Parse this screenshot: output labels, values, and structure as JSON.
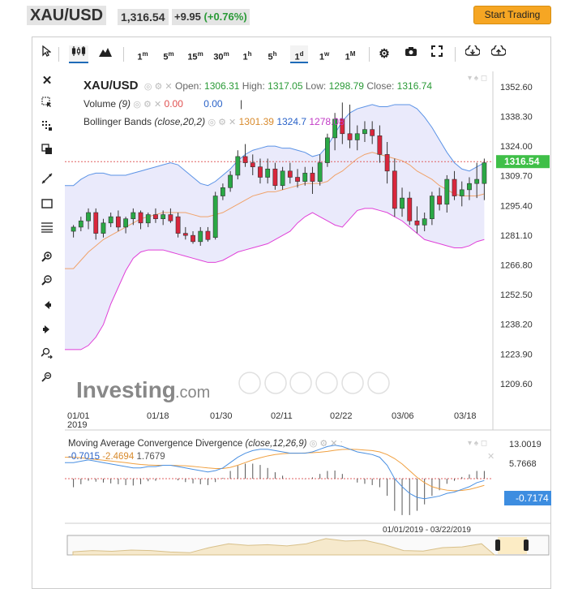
{
  "header": {
    "symbol": "XAU/USD",
    "price": "1,316.54",
    "change": "+9.95",
    "change_pct": "(+0.76%)",
    "trade_button": "Start Trading"
  },
  "toolbar": {
    "intervals": [
      "1m",
      "5m",
      "15m",
      "30m",
      "1h",
      "5h",
      "1d",
      "1w",
      "1M"
    ],
    "active_interval": "1d"
  },
  "legend": {
    "symbol": "XAU/USD",
    "open_label": "Open:",
    "open": "1306.31",
    "high_label": "High:",
    "high": "1317.05",
    "low_label": "Low:",
    "low": "1298.79",
    "close_label": "Close:",
    "close": "1316.74",
    "volume_label": "Volume",
    "volume_param": "(9)",
    "volume_v1": "0.00",
    "volume_v2": "0.00",
    "volume_v3": "|",
    "bb_label": "Bollinger Bands",
    "bb_param": "(close,20,2)",
    "bb_mid": "1301.39",
    "bb_up": "1324.7",
    "bb_low": "1278.08"
  },
  "macd": {
    "label": "Moving Average Convergence Divergence",
    "param": "(close,12,26,9)",
    "v1": "-0.7015",
    "v2": "-2.4694",
    "v3": "1.7679"
  },
  "watermark": {
    "brand": "Investing",
    "suffix": ".com"
  },
  "colors": {
    "up": "#2aa845",
    "down": "#d9263c",
    "bb_mid": "#f0a36b",
    "bb_up": "#5b93e6",
    "bb_low": "#e040d8",
    "bb_fill": "#e8e8fb",
    "macd": "#4a90e2",
    "signal": "#f0a040",
    "price_tag": "#3fbf48"
  },
  "chart_data": [
    {
      "type": "candlestick",
      "title": "XAU/USD",
      "x_labels": [
        "01/01\n2019",
        "01/18",
        "01/30",
        "02/11",
        "02/22",
        "03/06",
        "03/18"
      ],
      "y_ticks": [
        1352.6,
        1338.3,
        1324.0,
        1309.7,
        1295.4,
        1281.1,
        1266.8,
        1252.5,
        1238.2,
        1223.9,
        1209.6
      ],
      "ylim": [
        1199,
        1360
      ],
      "last_price": "1316.54",
      "candles": [
        [
          1283,
          1286,
          1280,
          1285
        ],
        [
          1285,
          1290,
          1283,
          1288
        ],
        [
          1288,
          1294,
          1284,
          1292
        ],
        [
          1292,
          1294,
          1279,
          1282
        ],
        [
          1282,
          1289,
          1280,
          1287
        ],
        [
          1287,
          1292,
          1285,
          1290
        ],
        [
          1290,
          1293,
          1283,
          1285
        ],
        [
          1285,
          1290,
          1282,
          1289
        ],
        [
          1289,
          1294,
          1286,
          1292
        ],
        [
          1292,
          1293,
          1284,
          1287
        ],
        [
          1287,
          1292,
          1285,
          1291
        ],
        [
          1291,
          1294,
          1287,
          1289
        ],
        [
          1289,
          1293,
          1286,
          1291
        ],
        [
          1291,
          1294,
          1287,
          1288
        ],
        [
          1290,
          1292,
          1280,
          1282
        ],
        [
          1282,
          1285,
          1279,
          1281
        ],
        [
          1281,
          1283,
          1277,
          1278
        ],
        [
          1278,
          1285,
          1276,
          1283
        ],
        [
          1283,
          1285,
          1278,
          1279
        ],
        [
          1280,
          1302,
          1279,
          1300
        ],
        [
          1300,
          1306,
          1298,
          1304
        ],
        [
          1304,
          1312,
          1302,
          1310
        ],
        [
          1310,
          1322,
          1308,
          1319
        ],
        [
          1319,
          1325,
          1314,
          1316
        ],
        [
          1316,
          1320,
          1310,
          1314
        ],
        [
          1314,
          1318,
          1306,
          1309
        ],
        [
          1309,
          1318,
          1306,
          1313
        ],
        [
          1313,
          1316,
          1303,
          1305
        ],
        [
          1305,
          1314,
          1303,
          1312
        ],
        [
          1312,
          1316,
          1306,
          1309
        ],
        [
          1309,
          1313,
          1304,
          1307
        ],
        [
          1307,
          1314,
          1305,
          1311
        ],
        [
          1311,
          1314,
          1301,
          1307
        ],
        [
          1307,
          1320,
          1305,
          1316
        ],
        [
          1316,
          1330,
          1314,
          1328
        ],
        [
          1328,
          1340,
          1322,
          1337
        ],
        [
          1337,
          1345,
          1325,
          1330
        ],
        [
          1330,
          1344,
          1323,
          1327
        ],
        [
          1327,
          1334,
          1322,
          1330
        ],
        [
          1330,
          1336,
          1326,
          1332
        ],
        [
          1332,
          1336,
          1325,
          1329
        ],
        [
          1329,
          1334,
          1316,
          1320
        ],
        [
          1320,
          1326,
          1306,
          1312
        ],
        [
          1312,
          1318,
          1290,
          1294
        ],
        [
          1294,
          1304,
          1290,
          1299
        ],
        [
          1299,
          1302,
          1286,
          1288
        ],
        [
          1288,
          1295,
          1282,
          1286
        ],
        [
          1286,
          1292,
          1283,
          1289
        ],
        [
          1289,
          1302,
          1286,
          1300
        ],
        [
          1300,
          1304,
          1293,
          1296
        ],
        [
          1296,
          1310,
          1292,
          1308
        ],
        [
          1308,
          1312,
          1298,
          1300
        ],
        [
          1300,
          1307,
          1295,
          1303
        ],
        [
          1303,
          1309,
          1298,
          1306
        ],
        [
          1306,
          1316,
          1299,
          1308
        ],
        [
          1306,
          1318,
          1298,
          1316
        ]
      ],
      "bb_upper": [
        1305,
        1308,
        1310,
        1311,
        1311,
        1310,
        1310,
        1310,
        1311,
        1312,
        1313,
        1314,
        1315,
        1316,
        1315,
        1312,
        1309,
        1306,
        1305,
        1307,
        1310,
        1313,
        1317,
        1320,
        1322,
        1323,
        1324,
        1324,
        1323,
        1323,
        1322,
        1321,
        1319,
        1320,
        1324,
        1330,
        1336,
        1340,
        1342,
        1343,
        1344,
        1343,
        1343,
        1344,
        1344,
        1344,
        1342,
        1338,
        1333,
        1327,
        1321,
        1316,
        1313,
        1312,
        1314,
        1316
      ],
      "bb_lower": [
        1226,
        1226,
        1228,
        1232,
        1238,
        1248,
        1256,
        1264,
        1270,
        1273,
        1274,
        1274,
        1274,
        1273,
        1272,
        1271,
        1270,
        1269,
        1268,
        1268,
        1269,
        1271,
        1273,
        1274,
        1275,
        1276,
        1277,
        1279,
        1281,
        1283,
        1287,
        1290,
        1292,
        1290,
        1288,
        1286,
        1285,
        1289,
        1293,
        1294,
        1294,
        1293,
        1292,
        1290,
        1288,
        1285,
        1282,
        1279,
        1278,
        1277,
        1276,
        1275,
        1275,
        1276,
        1278,
        1279
      ],
      "bb_mid": [
        1265,
        1269,
        1273,
        1276,
        1279,
        1281,
        1283,
        1285,
        1287,
        1289,
        1290,
        1291,
        1292,
        1292,
        1292,
        1292,
        1291,
        1290,
        1290,
        1291,
        1292,
        1294,
        1296,
        1298,
        1300,
        1301,
        1302,
        1302,
        1303,
        1304,
        1305,
        1306,
        1306,
        1306,
        1307,
        1310,
        1312,
        1315,
        1318,
        1320,
        1321,
        1320,
        1319,
        1318,
        1317,
        1315,
        1312,
        1310,
        1308,
        1305,
        1303,
        1301,
        1300,
        1300,
        1300,
        1301
      ]
    },
    {
      "type": "line",
      "title": "Moving Average Convergence Divergence",
      "y_ticks": [
        13.0019,
        5.7668
      ],
      "last_value": "-0.7174",
      "date_range": "01/01/2019 - 03/22/2019",
      "macd": [
        6,
        6.5,
        7,
        6.5,
        6,
        5.5,
        5,
        4.5,
        4,
        4,
        4.5,
        4.5,
        5,
        5,
        4.5,
        4,
        3.5,
        3,
        2.5,
        3,
        4,
        6,
        8,
        9.5,
        10.5,
        11,
        11,
        10.5,
        10,
        9.5,
        9.5,
        9.5,
        10,
        11,
        12,
        12.5,
        12,
        11,
        10,
        9.5,
        9,
        8,
        5,
        0,
        -3,
        -5.5,
        -7,
        -7.5,
        -7,
        -6.5,
        -5.5,
        -5,
        -4,
        -3,
        -1.5,
        -0.7
      ],
      "signal": [
        8,
        7.8,
        7.5,
        7.2,
        6.9,
        6.6,
        6.3,
        6,
        5.6,
        5.3,
        5.1,
        5,
        5,
        5,
        4.9,
        4.8,
        4.6,
        4.3,
        4,
        3.8,
        3.8,
        4.2,
        5,
        6,
        7,
        7.8,
        8.5,
        9,
        9.3,
        9.5,
        9.5,
        9.6,
        9.7,
        9.9,
        10.2,
        10.6,
        10.9,
        11,
        10.9,
        10.7,
        10.5,
        10,
        9,
        7.5,
        5.5,
        3,
        0.5,
        -1.5,
        -3,
        -3.8,
        -4.3,
        -4.5,
        -4.4,
        -4,
        -3.3,
        -2.5
      ],
      "hist": [
        -2,
        -1.3,
        -0.5,
        -0.7,
        -0.9,
        -1.1,
        -1.3,
        -1.5,
        -1.6,
        -1.3,
        -0.6,
        -0.5,
        0,
        0,
        -0.4,
        -0.8,
        -1.1,
        -1.3,
        -1.5,
        -0.8,
        0.2,
        1.8,
        3,
        3.5,
        3.5,
        3.2,
        2.5,
        1.5,
        0.7,
        0,
        0,
        -0.1,
        0.3,
        1.1,
        1.8,
        1.9,
        1.1,
        0,
        -0.9,
        -1.2,
        -1.5,
        -2,
        -4,
        -7.5,
        -8.5,
        -8.5,
        -7.5,
        -6,
        -4,
        -2.7,
        -1.2,
        -0.5,
        0.4,
        1,
        1.8,
        1.8
      ]
    }
  ]
}
